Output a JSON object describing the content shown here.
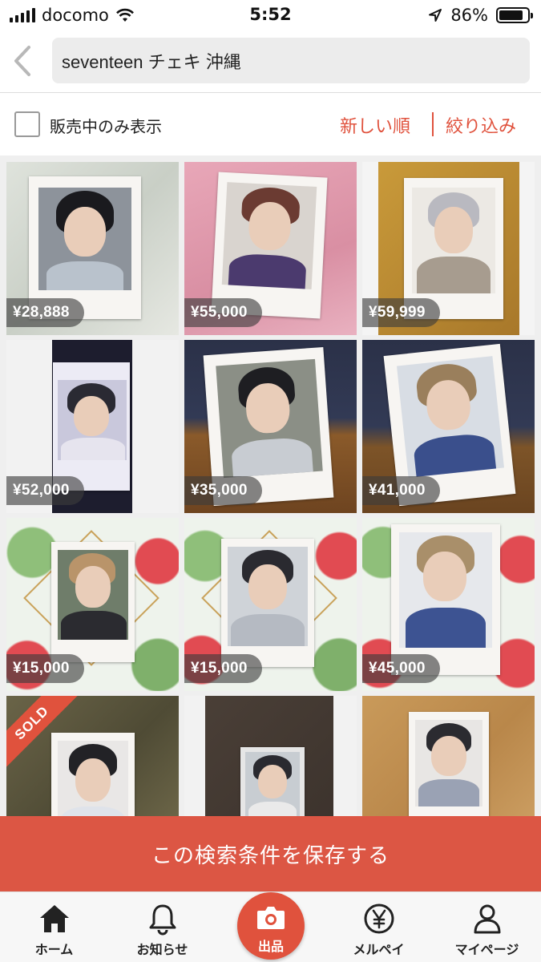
{
  "status_bar": {
    "carrier": "docomo",
    "time": "5:52",
    "battery_percent": "86%",
    "battery_level": 0.86
  },
  "search": {
    "query": "seventeen チェキ 沖縄"
  },
  "filter": {
    "on_sale_only_label": "販売中のみ表示",
    "sort_label": "新しい順",
    "refine_label": "絞り込み"
  },
  "items": [
    {
      "price": "¥28,888",
      "sold": false
    },
    {
      "price": "¥55,000",
      "sold": false
    },
    {
      "price": "¥59,999",
      "sold": false
    },
    {
      "price": "¥52,000",
      "sold": false
    },
    {
      "price": "¥35,000",
      "sold": false
    },
    {
      "price": "¥41,000",
      "sold": false
    },
    {
      "price": "¥15,000",
      "sold": false
    },
    {
      "price": "¥15,000",
      "sold": false
    },
    {
      "price": "¥45,000",
      "sold": false
    },
    {
      "price": "",
      "sold": true,
      "sold_label": "SOLD"
    },
    {
      "price": "",
      "sold": false
    },
    {
      "price": "",
      "sold": false
    }
  ],
  "save_search": {
    "label": "この検索条件を保存する"
  },
  "tab_bar": {
    "home": "ホーム",
    "notifications": "お知らせ",
    "sell": "出品",
    "merpay": "メルペイ",
    "mypage": "マイページ"
  },
  "colors": {
    "accent": "#e0523d",
    "banner": "#dc5644"
  },
  "icons": {
    "back": "chevron-left-icon",
    "home": "home-icon",
    "notifications": "bell-icon",
    "sell": "camera-icon",
    "merpay": "yen-circle-icon",
    "mypage": "person-icon"
  }
}
